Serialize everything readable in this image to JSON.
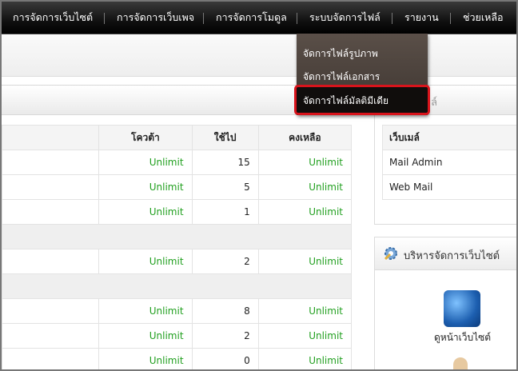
{
  "nav": {
    "items": [
      "การจัดการเว็บไซต์",
      "การจัดการเว็บเพจ",
      "การจัดการโมดูล",
      "ระบบจัดการไฟล์",
      "รายงาน",
      "ช่วยเหลือ"
    ]
  },
  "dropdown": {
    "items": [
      "จัดการไฟล์รูปภาพ",
      "จัดการไฟล์เอกสาร",
      "จัดการไฟล์มัลติมีเดีย"
    ],
    "active_index": 2
  },
  "right_panel_title_fragment": "ล์",
  "quota_table": {
    "headers": [
      "โควต้า",
      "ใช้ไป",
      "คงเหลือ"
    ],
    "rows": [
      {
        "type": "data",
        "quota": "Unlimit",
        "used": "15",
        "remaining": "Unlimit"
      },
      {
        "type": "data",
        "quota": "Unlimit",
        "used": "5",
        "remaining": "Unlimit"
      },
      {
        "type": "data",
        "quota": "Unlimit",
        "used": "1",
        "remaining": "Unlimit"
      },
      {
        "type": "group"
      },
      {
        "type": "data",
        "quota": "Unlimit",
        "used": "2",
        "remaining": "Unlimit"
      },
      {
        "type": "group"
      },
      {
        "type": "data",
        "quota": "Unlimit",
        "used": "8",
        "remaining": "Unlimit"
      },
      {
        "type": "data",
        "quota": "Unlimit",
        "used": "2",
        "remaining": "Unlimit"
      },
      {
        "type": "data",
        "quota": "Unlimit",
        "used": "0",
        "remaining": "Unlimit"
      }
    ]
  },
  "mail_table": {
    "header": "เว็บเมล์",
    "rows": [
      "Mail Admin",
      "Web Mail"
    ]
  },
  "site_admin": {
    "title": "บริหารจัดการเว็บไซต์",
    "view_site_label": "ดูหน้าเว็บไซต์"
  },
  "colors": {
    "unlimit": "#22a020",
    "highlight_border": "#d8141c"
  }
}
